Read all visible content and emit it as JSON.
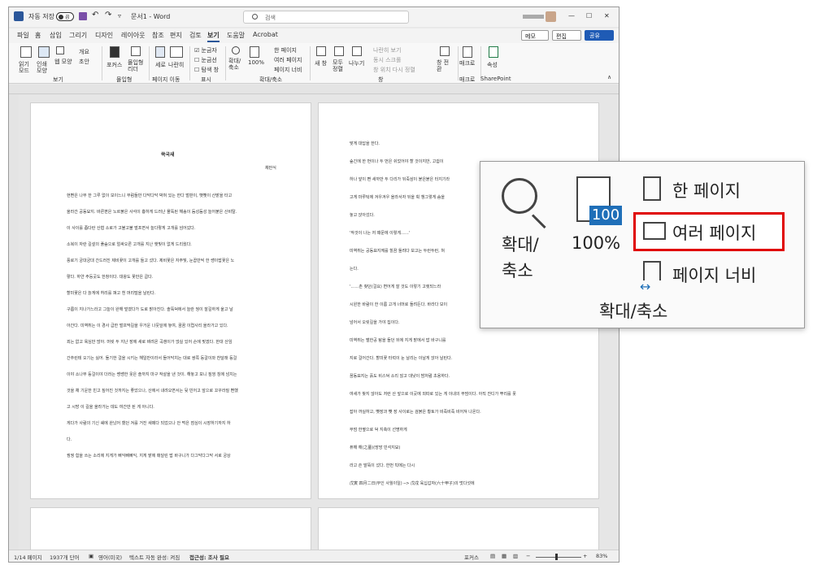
{
  "titlebar": {
    "autosave": "자동 저장",
    "autosave_state": "끔",
    "doc_title": "문서1 - Word",
    "search_placeholder": "검색"
  },
  "tabs": [
    "파일",
    "홈",
    "삽입",
    "그리기",
    "디자인",
    "레이아웃",
    "참조",
    "편지",
    "검토",
    "보기",
    "도움말",
    "Acrobat"
  ],
  "active_tab": "보기",
  "right_buttons": {
    "memo": "메모",
    "edit": "편집",
    "share": "공유"
  },
  "ribbon": {
    "view": {
      "read_mode": "읽기 모드",
      "print_layout": "인쇄 모양",
      "web_layout": "웹 모양",
      "outline": "개요",
      "draft": "초안",
      "group": "보기"
    },
    "immersive": {
      "focus": "포커스",
      "reader": "몰입형 리더",
      "group": "몰입형"
    },
    "page_move": {
      "vertical": "세로",
      "side": "나란히",
      "group": "페이지 이동"
    },
    "show": {
      "ruler": "눈금자",
      "gridlines": "눈금선",
      "nav": "탐색 창",
      "group": "표시"
    },
    "zoom": {
      "zoom": "확대/축소",
      "pct": "100%",
      "one_page": "한 페이지",
      "multi_page": "여러 페이지",
      "page_width": "페이지 너비",
      "group": "확대/축소"
    },
    "window": {
      "new": "새 창",
      "arrange": "모두 정렬",
      "split": "나누기",
      "side_by_side": "나란히 보기",
      "sync_scroll": "동시 스크롤",
      "reset": "창 위치 다시 정렬",
      "switch": "창 전환",
      "group": "창"
    },
    "macro": {
      "label": "매크로",
      "group": "매크로"
    },
    "sp": {
      "label": "속성",
      "group": "SharePoint"
    }
  },
  "page1": {
    "title": "쑥국새",
    "author": "채만식",
    "lines": [
      "현뻔은 나무 한 그루 없이 보이느니 무럼들만 다닥다닥 박혀 있는 한다 벌판이, 뻣뻣이 산밭을 타고",
      "올라간 공동묘지. 바른편은 노르붉은 사석이 흉하게 드러난 몰뚝된 해송이 듬성듬성 늘어붙은 산비탈.",
      "이 사이를 좁다란 산협 소로가 고불고불 벌프면서 늘다랗게 고개를 넘어갔다.",
      "소복이 자란 길섶의 풀숲으로 얼싸오른 고개를 지난 햇빛이 없게 드리웠다.",
      "풍로기 궁대궁대 간드러진 제비꽃이 고개를 들고 섰다. 제비꽃은 자주빛, 눈꼽만씩 한 쌩이밥꽃은 노",
      "랗다. 하얀 주둥곳도 한창이다. 대왕도 꽃만은 곱다.",
      "할미꽃은 다 늙게에 허리를 펴고 흰 머리털을 날린다.",
      "구름이 지나가느라고 그늘이 완해 덮였다가 도로 밝아진다. 솔뚝덕에서 늘란 꿩이 잘길하게 울고 날",
      "아간다. 미역취는 이 경사 급한 벌프막길을 우거운 나뭇잎에 놓여, 꿈꿈 이렵사리 올라가고 있다.",
      "꾀는 없고 욕심만 많아. 머릿 두 지난 장에 새로 벼려온 곡괭이가 얹실 있어 손에 맞겠다. 한대 산임",
      "간추린테 오기는 싫어. 둘기한 걸을 시키는 해일반이라서 들어닥치는 대로 쌍쪽 등갈이와 찬달래 등걸",
      "이야 소나무 등걸이야 더러는 쌩쌩한 옷은 솔까지 마구 작살을 낸 것이. 해놓고 보니 짚껑 칭에 넘치는",
      "것을 채 기운한 빈고 짚어진 것까지는 좋았으나, 산에서 내려오면서는 뒷 빈어고 앞으로 꼬꾸라질 뻔했",
      "고 시방 이 길을 올라가는 데도 여간만 된 게 아니다.",
      "게다가 사람의 기신 쉐에 완났어 했던 겨를 거진 새떼다 되었으나 안 먹은 점심이 시장하기까지 하",
      "다.",
      "꿩꿩 힘을 쓰는 소리에 지게가 삐익뼈삐익, 지게 밭에 매달린 밥 바구니가 다그닥다그닥 서로 궁상"
    ]
  },
  "page2": {
    "lines": [
      "맞게 대답을 한다.",
      "숲긴에 한 번이나 두 번은 쉬었어야 할 것이지만, 고쉽이",
      "하나 앞이 뻔 새까만 두 다리가 뒤죽삼이 붙은붙은 터지기라",
      "고게 마루턱에 겨우겨우 올라서자 뒤을 휙 챙그렇게 숨을",
      "놓고 앉아섰다.",
      "'작것이 나는 저 때문에 이렇게……'",
      "미역취는 공동묘지께를 힐끔 돌려다 보고는 두런두런, 혀",
      "는다.",
      "'……촌 찾던(걸요) 변어게 잘 것도 이렇기 고렛되느라",
      "시원한 바람이 한 이름 고개 너머로 돌려든다. 바라다 보이",
      "넘어서 오릿길을 가야 집이다.",
      "미역취는 밸한공 탐을 들던 뒤에 지게 밭에서 밥 바구니를",
      "지로 걸어간다. 할미꽃 터럭이 눈 날리는 이날게 앉아 날린다.",
      "꿈동묘지는 흙도 비스덕 소리 않고 대낮이 밤처럼 초용하다.",
      "여새가 찾지 않아도 저런 산 앞으로 이곳에 외따로 있는 게 이내의 무덤이다. 아직 잔디가 뿌리를 못",
      "잡아 까실하고, 뺏장과 뺏 장 사이로는 검붉은 황토가 비죽비죽 비어져 나온다.",
      "무덤 한옆으로 덕 지축이 선명하게",
      "퓨해 해(之墓)(망망 빈석지묘)",
      "라고 쓴 말뚝이 섰다. 한번 빅에는 다시",
      "戊寅 四月二日(무인 사월이일) ─> 戊戌 육십갑자(六十甲子)의 멋다섯에"
    ]
  },
  "status": {
    "page": "1/14 페이지",
    "words": "1937개 단어",
    "lang": "영어(미국)",
    "predict": "텍스트 자동 완성: 켜짐",
    "access": "접근성: 조사 필요",
    "focus": "포커스",
    "zoom_pct": "83%"
  },
  "zoom_callout": {
    "zoom": "확대/축소",
    "pct_badge": "100",
    "pct": "100%",
    "one_page": "한 페이지",
    "multi_page": "여러 페이지",
    "page_width": "페이지 너비",
    "group": "확대/축소",
    "highlight_color": "#e00000"
  }
}
